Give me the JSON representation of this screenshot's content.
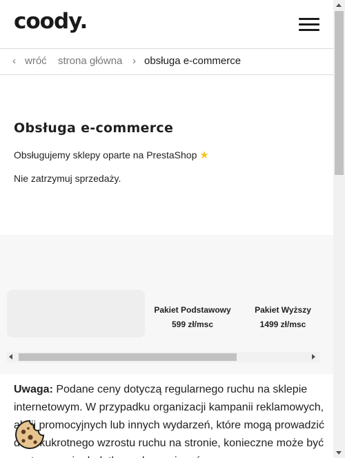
{
  "header": {
    "logo_text": "coody.",
    "menu_icon": "hamburger-menu-icon"
  },
  "breadcrumb": {
    "back_icon": "‹",
    "back_label": "wróć",
    "home_label": "strona główna",
    "separator": "›",
    "current_label": "obsługa e-commerce"
  },
  "intro": {
    "title": "Obsługa e-commerce",
    "line1": "Obsługujemy sklepy oparte na PrestaShop",
    "line1_icon": "star-icon",
    "line2": "Nie zatrzymuj sprzedaży."
  },
  "pricing": {
    "plans": [
      {
        "name": "Pakiet Podstawowy",
        "price": "599 zł/msc"
      },
      {
        "name": "Pakiet Wyższy",
        "price": "1499 zł/msc"
      }
    ]
  },
  "note": {
    "label": "Uwaga:",
    "text": " Podane ceny dotyczą regularnego ruchu na sklepie internetowym. W przypadku organizacji kampanii reklamowych, akcji promocyjnych lub innych wydarzeń, które mogą prowadzić do kilkukrotnego wzrostu ruchu na stronie, konieczne może być zastosowanie dodatkowych rozwiązań."
  },
  "cookie": {
    "icon": "cookie-icon"
  },
  "colors": {
    "accent_star": "#f5c518",
    "text": "#1f1f1f",
    "muted": "#777777",
    "section_bg": "#f7f7f7"
  }
}
